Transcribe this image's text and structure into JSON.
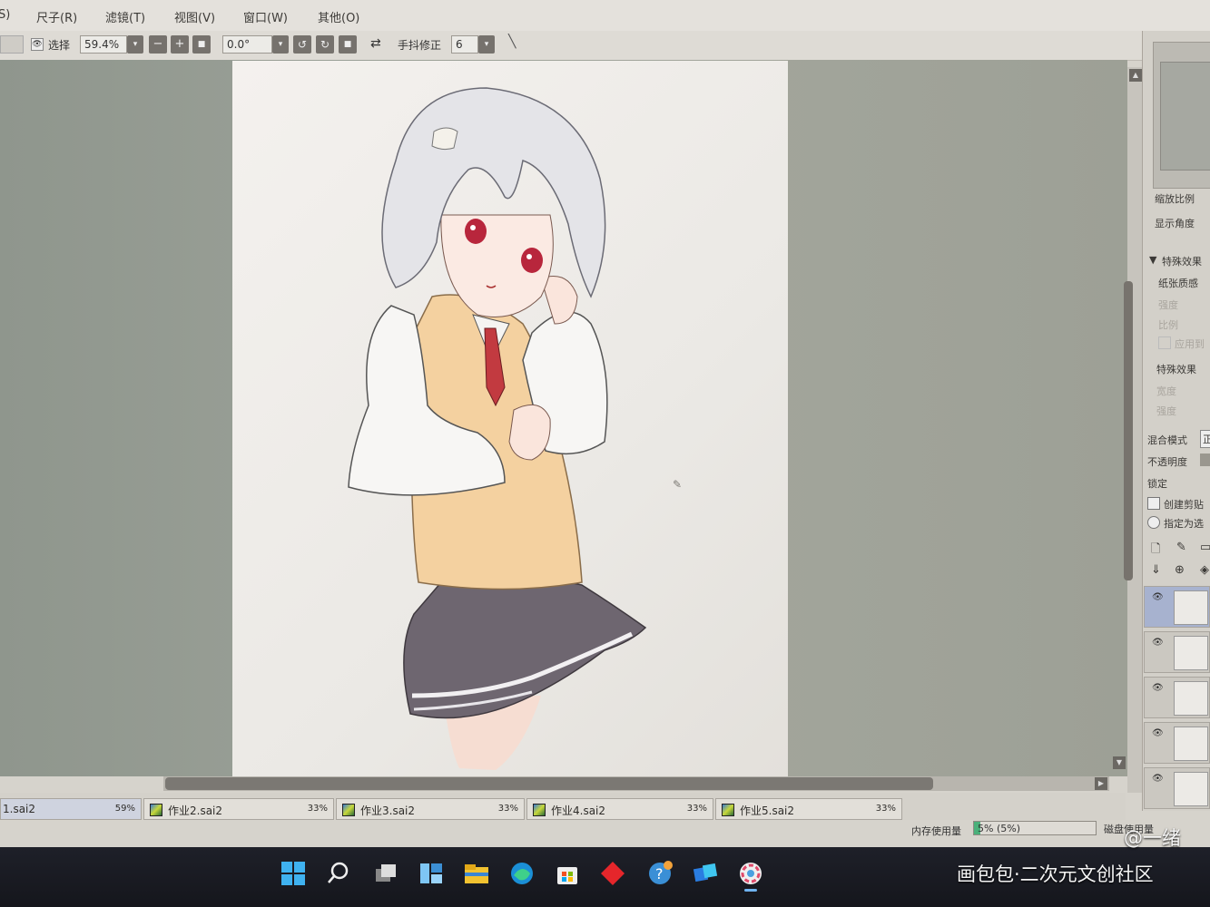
{
  "menu": [
    "S)",
    "尺子(R)",
    "滤镜(T)",
    "视图(V)",
    "窗口(W)",
    "其他(O)"
  ],
  "toolbar": {
    "select_label": "选择",
    "zoom_value": "59.4%",
    "angle_value": "0.0°",
    "stabilizer_label": "手抖修正",
    "stabilizer_value": "6"
  },
  "right_panel": {
    "zoom_label": "缩放比例",
    "angle_label": "显示角度",
    "effects_header": "特殊效果",
    "paper_texture": "纸张质感",
    "intensity": "强度",
    "scale": "比例",
    "apply_to": "应用到",
    "effects_label": "特殊效果",
    "width": "宽度",
    "strength": "强度",
    "blend_mode": "混合模式",
    "blend_value": "正",
    "opacity": "不透明度",
    "lock": "锁定",
    "clipping": "创建剪贴",
    "selection_source": "指定为选"
  },
  "tabs": [
    {
      "name": "1.sai2",
      "pct": "59%",
      "active": true
    },
    {
      "name": "作业2.sai2",
      "pct": "33%",
      "active": false
    },
    {
      "name": "作业3.sai2",
      "pct": "33%",
      "active": false
    },
    {
      "name": "作业4.sai2",
      "pct": "33%",
      "active": false
    },
    {
      "name": "作业5.sai2",
      "pct": "33%",
      "active": false
    }
  ],
  "status": {
    "memory_label": "内存使用量",
    "memory_value": "5% (5%)",
    "memory_fraction": 0.05,
    "disk_label": "磁盘使用量"
  },
  "watermark": {
    "handle": "@一绪",
    "site": "画包包·二次元文创社区"
  },
  "colors": {
    "canvas_bg": "#9aa097",
    "paper": "#f2efeb",
    "taskbar": "#1a1b22",
    "selected_layer": "#a7b2cf"
  },
  "taskbar_icons": [
    "windows-start-icon",
    "search-icon",
    "task-view-icon",
    "widgets-icon",
    "file-explorer-icon",
    "edge-browser-icon",
    "store-icon",
    "red-diamond-app-icon",
    "help-app-icon",
    "blue-squares-app-icon",
    "paint-tool-sai-icon"
  ]
}
